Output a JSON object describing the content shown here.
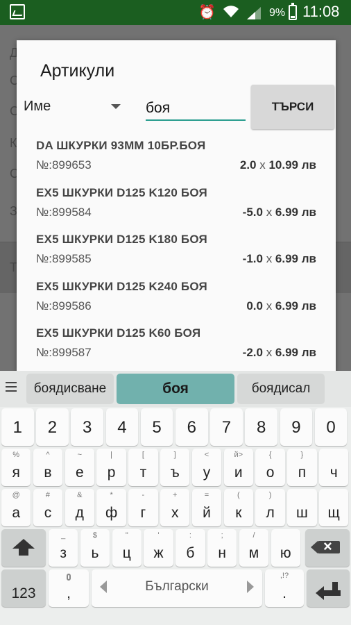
{
  "status_bar": {
    "battery": "9%",
    "time": "11:08"
  },
  "dialog": {
    "title": "Артикули",
    "filter_field": "Име",
    "search_value": "боя",
    "search_button": "ТЪРСИ",
    "results": [
      {
        "name": "DA ШКУРКИ 93ММ 10БР.БОЯ",
        "number": "№:899653",
        "qty": "2.0",
        "x": "x",
        "price": "10.99",
        "currency": "лв"
      },
      {
        "name": "EX5 ШКУРКИ D125 K120 БОЯ",
        "number": "№:899584",
        "qty": "-5.0",
        "x": "x",
        "price": "6.99",
        "currency": "лв"
      },
      {
        "name": "EX5 ШКУРКИ D125 K180 БОЯ",
        "number": "№:899585",
        "qty": "-1.0",
        "x": "x",
        "price": "6.99",
        "currency": "лв"
      },
      {
        "name": "EX5 ШКУРКИ D125 K240 БОЯ",
        "number": "№:899586",
        "qty": "0.0",
        "x": "x",
        "price": "6.99",
        "currency": "лв"
      },
      {
        "name": "EX5 ШКУРКИ D125 K60 БОЯ",
        "number": "№:899587",
        "qty": "-2.0",
        "x": "x",
        "price": "6.99",
        "currency": "лв"
      }
    ]
  },
  "background": {
    "rows": [
      "Д",
      "С",
      "С",
      "К",
      "С",
      "З"
    ],
    "band_text": "Т"
  },
  "keyboard": {
    "suggestions": [
      "боядисване",
      "боя",
      "боядисал"
    ],
    "digits": [
      "1",
      "2",
      "3",
      "4",
      "5",
      "6",
      "7",
      "8",
      "9",
      "0"
    ],
    "row1": [
      {
        "k": "я",
        "h": "%"
      },
      {
        "k": "в",
        "h": "^"
      },
      {
        "k": "е",
        "h": "~"
      },
      {
        "k": "р",
        "h": "|"
      },
      {
        "k": "т",
        "h": "["
      },
      {
        "k": "ъ",
        "h": "]"
      },
      {
        "k": "у",
        "h": "<"
      },
      {
        "k": "и",
        "h": "й>"
      },
      {
        "k": "о",
        "h": "{"
      },
      {
        "k": "п",
        "h": "}"
      },
      {
        "k": "ч",
        "h": ""
      }
    ],
    "row2": [
      {
        "k": "а",
        "h": "@"
      },
      {
        "k": "с",
        "h": "#"
      },
      {
        "k": "д",
        "h": "&"
      },
      {
        "k": "ф",
        "h": "*"
      },
      {
        "k": "г",
        "h": "-"
      },
      {
        "k": "х",
        "h": "+"
      },
      {
        "k": "й",
        "h": "="
      },
      {
        "k": "к",
        "h": "("
      },
      {
        "k": "л",
        "h": ")"
      },
      {
        "k": "ш",
        "h": ""
      },
      {
        "k": "щ",
        "h": ""
      }
    ],
    "row3": [
      {
        "k": "з",
        "h": "_"
      },
      {
        "k": "ь",
        "h": "$"
      },
      {
        "k": "ц",
        "h": "\""
      },
      {
        "k": "ж",
        "h": "'"
      },
      {
        "k": "б",
        "h": ":"
      },
      {
        "k": "н",
        "h": ";"
      },
      {
        "k": "м",
        "h": "/"
      },
      {
        "k": "ю",
        "h": ""
      }
    ],
    "sym_key": "123",
    "comma_key": ",",
    "space_label": "Български",
    "period_key": ".",
    "period_hint": ",!?"
  }
}
